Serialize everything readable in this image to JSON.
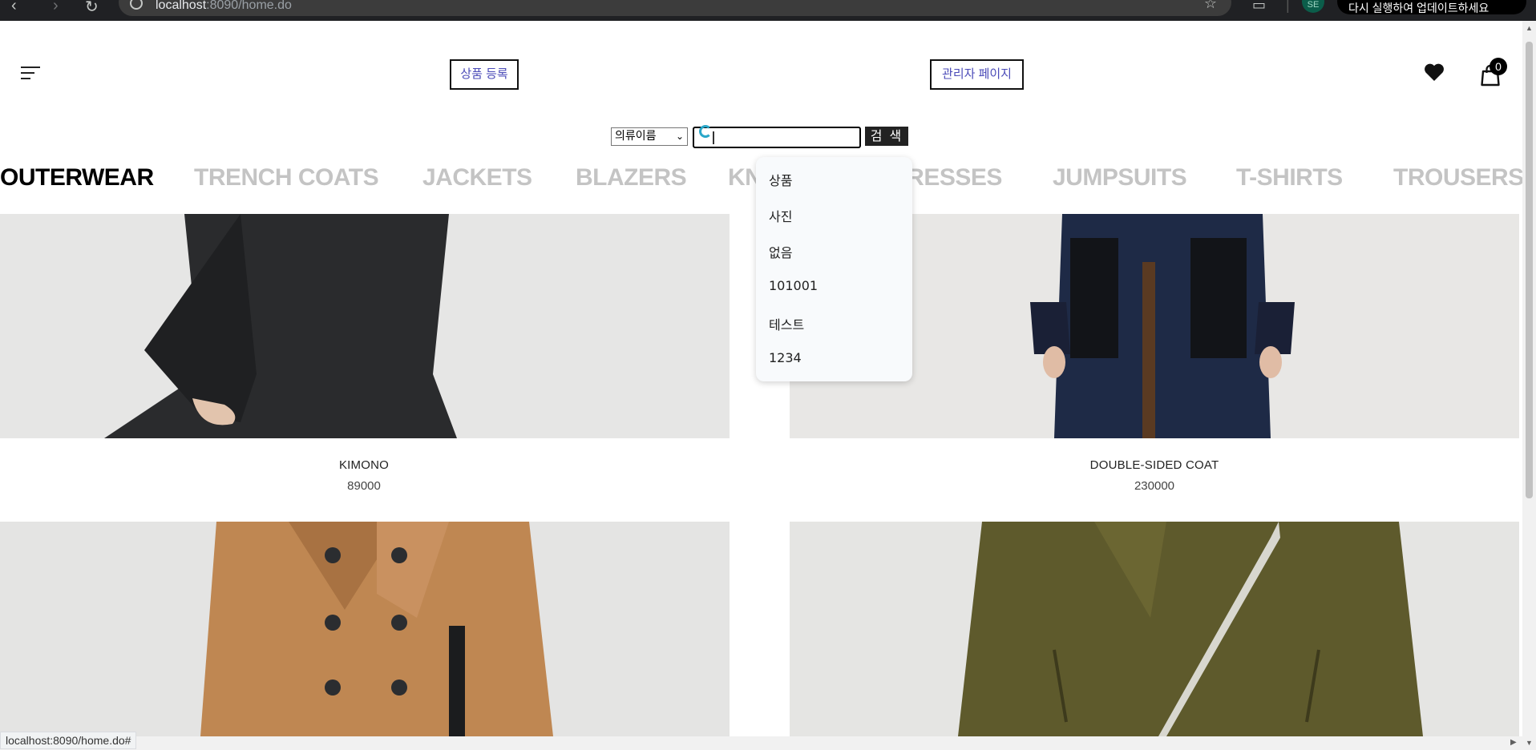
{
  "browser": {
    "url_host": "localhost",
    "url_rest": ":8090/home.do",
    "update_text": "다시 실행하여 업데이트하세요",
    "profile_initials": "SE"
  },
  "header": {
    "product_register_label": "상품 등록",
    "admin_page_label": "관리자 페이지",
    "cart_count": "0"
  },
  "search": {
    "select_value": "의류이름",
    "input_value": "",
    "button_label": "검 색",
    "suggestions": [
      "상품",
      "사진",
      "없음",
      "101001",
      "테스트",
      "1234"
    ]
  },
  "categories": [
    {
      "label": "OUTERWEAR",
      "active": true
    },
    {
      "label": "TRENCH COATS",
      "active": false
    },
    {
      "label": "JACKETS",
      "active": false
    },
    {
      "label": "BLAZERS",
      "active": false
    },
    {
      "label": "KNITWEAR",
      "active": false
    },
    {
      "label": "DRESSES",
      "active": false
    },
    {
      "label": "JUMPSUITS",
      "active": false
    },
    {
      "label": "T-SHIRTS",
      "active": false
    },
    {
      "label": "TROUSERS",
      "active": false
    }
  ],
  "products": [
    {
      "name": "KIMONO",
      "price": "89000"
    },
    {
      "name": "DOUBLE-SIDED COAT",
      "price": "230000"
    },
    {
      "name": "",
      "price": ""
    },
    {
      "name": "",
      "price": ""
    }
  ],
  "status_bar": {
    "text": "localhost:8090/home.do#"
  },
  "colors": {
    "link_text": "#4b4bb8",
    "category_active": "#000000",
    "category_inactive": "#c4c4c4",
    "coat_camel": "#bf8752",
    "coat_olive": "#5e5a2c",
    "coat_navy": "#1e2a46"
  }
}
